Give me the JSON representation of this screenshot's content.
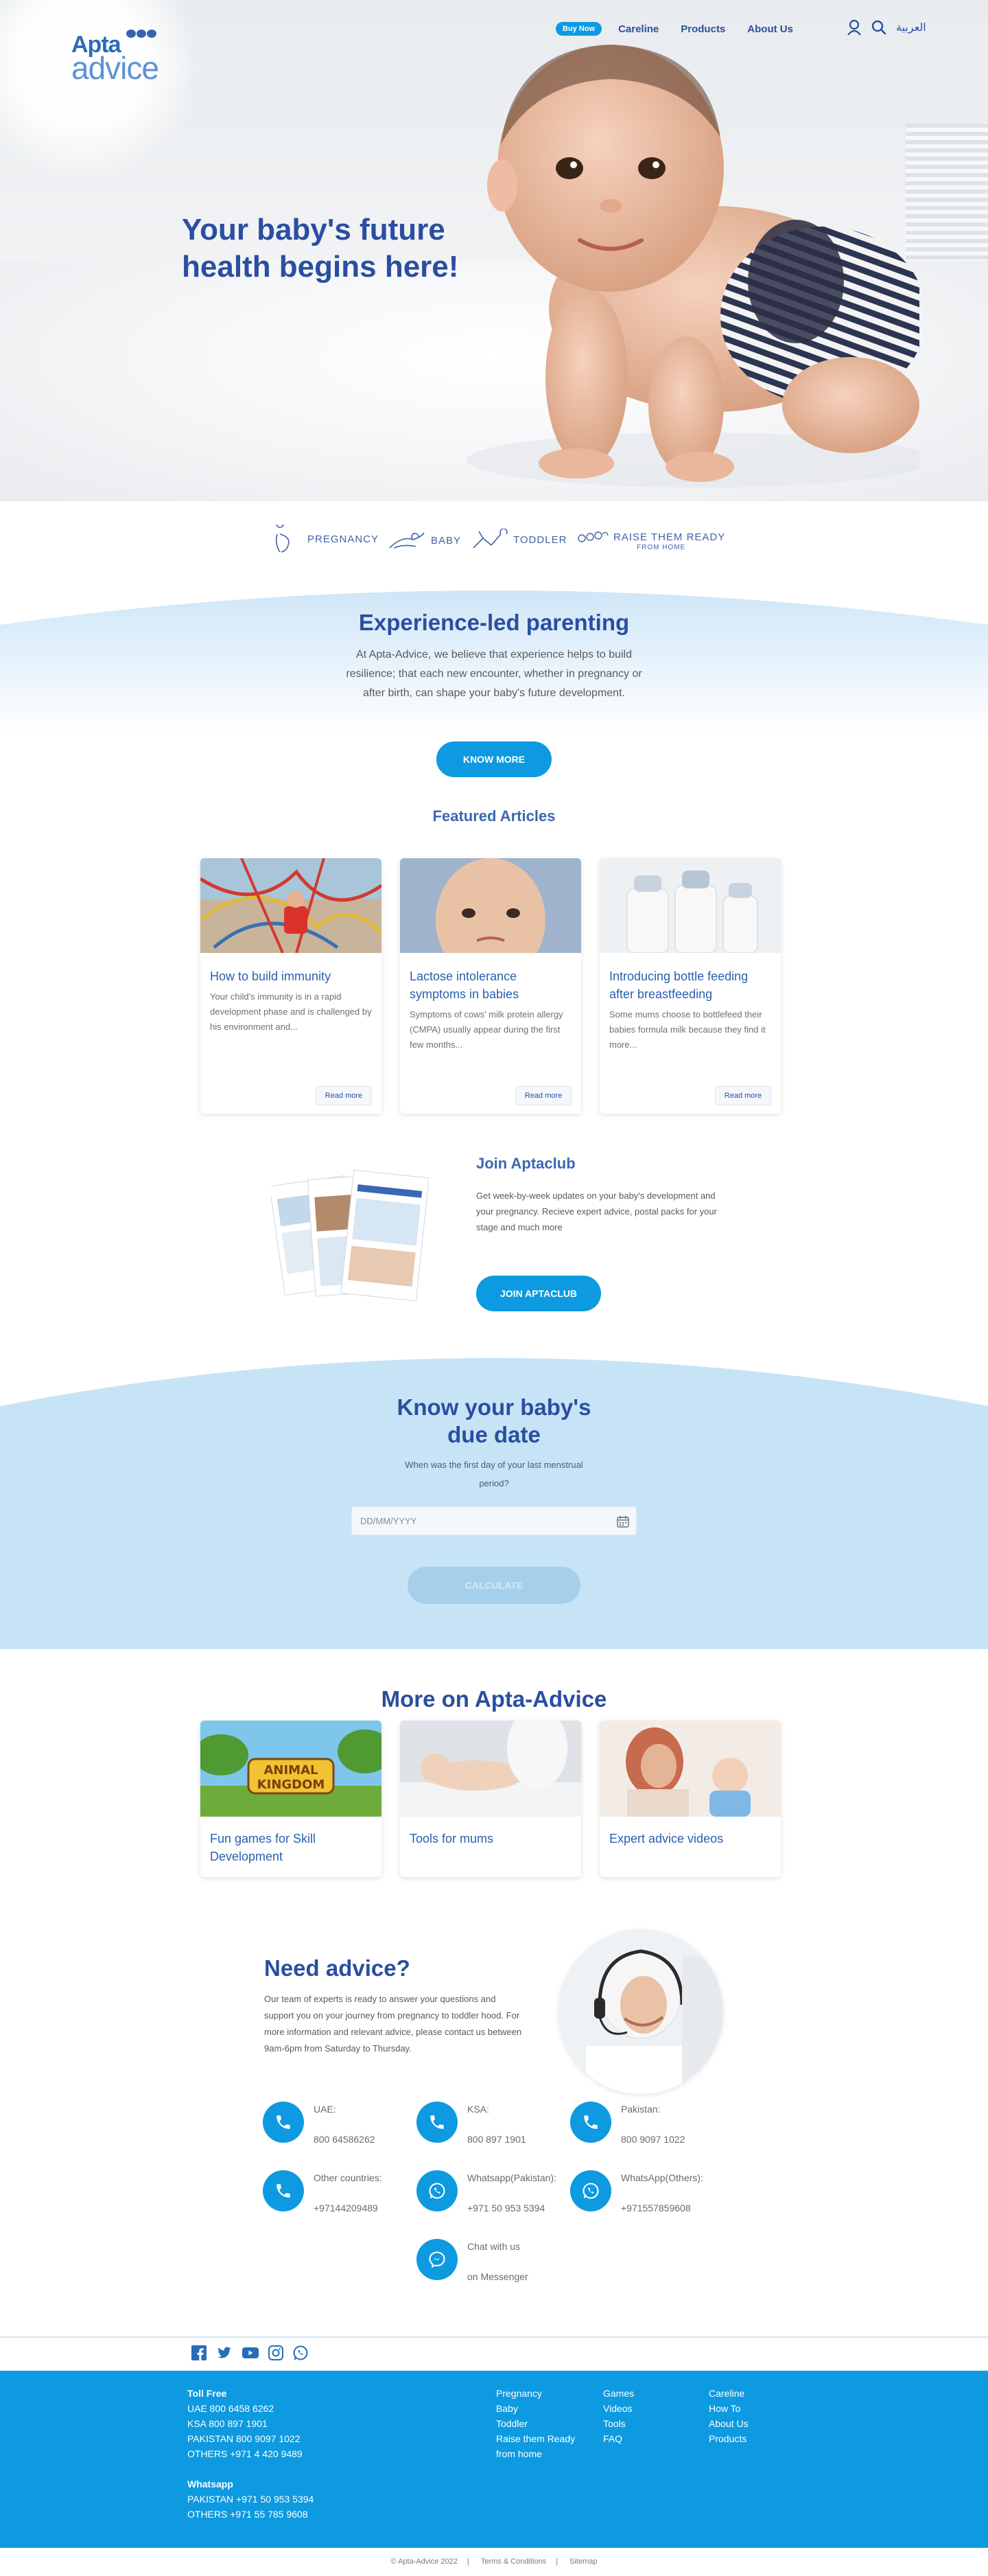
{
  "header": {
    "logo_top": "Apta",
    "logo_bottom": "advice",
    "buy_now": "Buy Now",
    "nav": [
      "Careline",
      "Products",
      "About Us"
    ],
    "arabic": "العربية"
  },
  "hero": {
    "title": "Your baby's future health begins here!"
  },
  "stages": [
    "PREGNANCY",
    "BABY",
    "TODDLER",
    "RAISE THEM READY"
  ],
  "stages_sub": "FROM HOME",
  "experience": {
    "title": "Experience-led parenting",
    "text": "At Apta-Advice, we believe that experience helps to build resilience; that each new encounter, whether in pregnancy or after birth, can shape your baby's future development.",
    "button": "KNOW MORE"
  },
  "featured": {
    "title": "Featured Articles",
    "articles": [
      {
        "title": "How to build immunity",
        "desc": "Your child's immunity is in a rapid development phase and is challenged by his environment and...",
        "cta": "Read more"
      },
      {
        "title": "Lactose intolerance symptoms in babies",
        "desc": "Symptoms of cows' milk protein allergy (CMPA) usually appear during the first few months...",
        "cta": "Read more"
      },
      {
        "title": "Introducing bottle feeding after breastfeeding",
        "desc": "Some mums choose to bottlefeed their babies formula milk because they find it more...",
        "cta": "Read more"
      }
    ]
  },
  "join": {
    "title": "Join Aptaclub",
    "text": "Get week-by-week updates on your baby's development and your pregnancy. Recieve expert advice, postal packs for your stage and much more",
    "button": "JOIN APTACLUB"
  },
  "due_date": {
    "title": "Know your baby's due date",
    "question": "When was the first day of your last menstrual period?",
    "placeholder": "DD/MM/YYYY",
    "button": "CALCULATE"
  },
  "more": {
    "title": "More on Apta-Advice",
    "cards": [
      "Fun games for Skill Development",
      "Tools for mums",
      "Expert advice videos"
    ],
    "game_logo_line1": "ANIMAL",
    "game_logo_line2": "KINGDOM"
  },
  "advice": {
    "title": "Need advice?",
    "text": "Our team of experts is ready to answer your questions and support you on your journey from pregnancy to toddler hood. For more information and relevant advice, please contact us between 9am-6pm from Saturday to Thursday.",
    "contacts": [
      {
        "label": "UAE:",
        "value": "800 64586262",
        "icon": "phone-icon"
      },
      {
        "label": "KSA:",
        "value": "800 897 1901",
        "icon": "phone-icon"
      },
      {
        "label": "Pakistan:",
        "value": "800 9097 1022",
        "icon": "phone-icon"
      },
      {
        "label": "Other countries:",
        "value": "+97144209489",
        "icon": "phone-icon"
      },
      {
        "label": "Whatsapp(Pakistan):",
        "value": "+971 50 953 5394",
        "icon": "whatsapp-icon"
      },
      {
        "label": "WhatsApp(Others):",
        "value": "+971557859608",
        "icon": "whatsapp-icon"
      },
      {
        "label": "Chat with us",
        "value": "on Messenger",
        "icon": "messenger-icon"
      }
    ]
  },
  "social": [
    "facebook-icon",
    "twitter-icon",
    "youtube-icon",
    "instagram-icon",
    "whatsapp-icon"
  ],
  "footer": {
    "toll_free_title": "Toll Free",
    "toll_free": [
      "UAE 800 6458 6262",
      "KSA 800 897 1901",
      "PAKISTAN 800 9097 1022",
      "OTHERS +971 4 420 9489"
    ],
    "whatsapp_title": "Whatsapp",
    "whatsapp": [
      "PAKISTAN +971 50 953 5394",
      "OTHERS +971 55 785 9608"
    ],
    "col1": [
      "Pregnancy",
      "Baby",
      "Toddler",
      "Raise them Ready",
      "from home"
    ],
    "col2": [
      "Games",
      "Videos",
      "Tools",
      "FAQ"
    ],
    "col3": [
      "Careline",
      "How To",
      "About Us",
      "Products"
    ],
    "copyright": "© Apta-Advice 2022",
    "terms": "Terms & Conditions",
    "sitemap": "Sitemap"
  },
  "colors": {
    "brand": "#0d9ae0",
    "heading": "#2a4ea0",
    "light_blue": "#c7e4f7"
  }
}
